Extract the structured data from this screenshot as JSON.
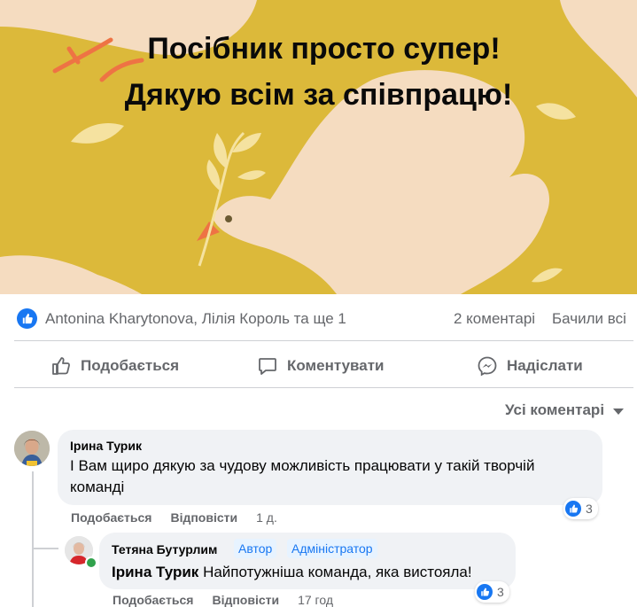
{
  "banner": {
    "line1": "Посібник просто супер!",
    "line2": "Дякую всім за співпрацю!",
    "background_color": "#dcb93a"
  },
  "reactions": {
    "reactors": "Antonina Kharytonova, Лілія Король та ще 1",
    "comments_count": "2 коментарі",
    "seen_all": "Бачили всі",
    "like_icon": "like-badge-icon"
  },
  "actions": {
    "like": "Подобається",
    "comment": "Коментувати",
    "share": "Надіслати"
  },
  "filter": {
    "label": "Усі коментарі"
  },
  "comments": [
    {
      "author": "Ірина Турик",
      "text": "І Вам щиро дякую за чудову можливість працювати у такій творчій команді",
      "like_label": "Подобається",
      "reply_label": "Відповісти",
      "time": "1 д.",
      "reactions": "3"
    },
    {
      "author": "Тетяна Бутурлим",
      "badges": [
        "Автор",
        "Адміністратор"
      ],
      "mention": "Ірина Турик",
      "text": "Найпотужніша команда, яка вистояла!",
      "like_label": "Подобається",
      "reply_label": "Відповісти",
      "time": "17 год",
      "reactions": "3"
    }
  ],
  "colors": {
    "accent": "#1877f2",
    "muted_text": "#65676b",
    "bubble": "#f0f2f5",
    "online": "#31a24c"
  }
}
